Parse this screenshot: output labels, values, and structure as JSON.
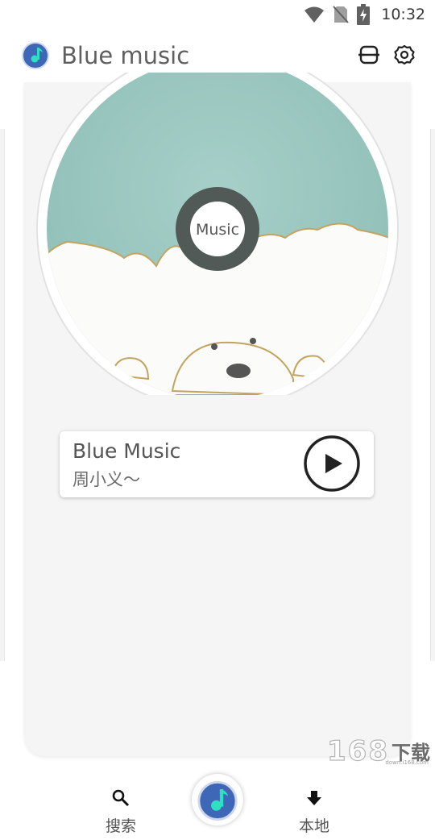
{
  "status_bar": {
    "time": "10:32"
  },
  "header": {
    "title": "Blue music",
    "icons": [
      "app-logo-icon",
      "scan-icon",
      "settings-gear-icon"
    ]
  },
  "disc": {
    "center_label": "Music"
  },
  "now_playing": {
    "title": "Blue Music",
    "artist": "周小义～"
  },
  "bottom_nav": {
    "search_label": "搜索",
    "local_label": "本地"
  },
  "watermark": {
    "digits": "168",
    "text": "下载",
    "sub": "down.i168.com"
  },
  "colors": {
    "logo_blue": "#3f67b8",
    "logo_note": "#2ee0c0",
    "disc_green": "#9cc7c0",
    "card_bg": "#f5f5f5"
  }
}
